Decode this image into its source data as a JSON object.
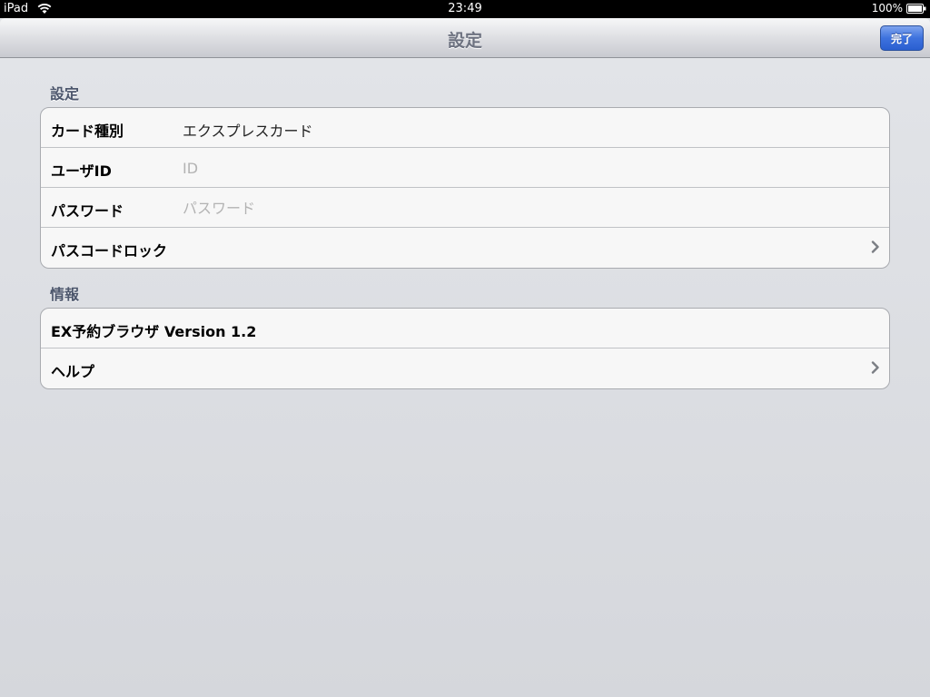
{
  "statusbar": {
    "device": "iPad",
    "time": "23:49",
    "battery": "100%"
  },
  "navbar": {
    "title": "設定",
    "done_label": "完了"
  },
  "sections": {
    "settings": {
      "header": "設定",
      "card_type_label": "カード種別",
      "card_type_value": "エクスプレスカード",
      "user_id_label": "ユーザID",
      "user_id_placeholder": "ID",
      "password_label": "パスワード",
      "password_placeholder": "パスワード",
      "passcode_lock_label": "パスコードロック"
    },
    "info": {
      "header": "情報",
      "version_label": "EX予約ブラウザ Version 1.2",
      "help_label": "ヘルプ"
    }
  },
  "colors": {
    "accent": "#2a5fd1",
    "section_header": "#4c566c",
    "background": "#d9dbe0"
  }
}
